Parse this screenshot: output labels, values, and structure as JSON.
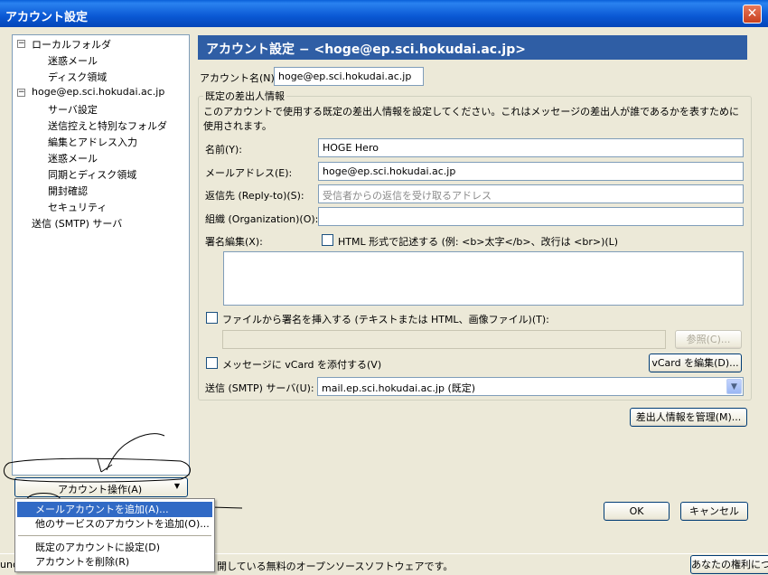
{
  "window": {
    "title": "アカウント設定",
    "close_symbol": "✕"
  },
  "tree": {
    "items": [
      {
        "label": "ローカルフォルダ",
        "expander": "−"
      },
      {
        "label": "迷惑メール"
      },
      {
        "label": "ディスク領域"
      },
      {
        "label": "hoge@ep.sci.hokudai.ac.jp",
        "expander": "−"
      },
      {
        "label": "サーバ設定"
      },
      {
        "label": "送信控えと特別なフォルダ"
      },
      {
        "label": "編集とアドレス入力"
      },
      {
        "label": "迷惑メール"
      },
      {
        "label": "同期とディスク領域"
      },
      {
        "label": "開封確認"
      },
      {
        "label": "セキュリティ"
      },
      {
        "label": "送信 (SMTP) サーバ"
      }
    ]
  },
  "account_ops": {
    "label": "アカウント操作(A)",
    "arrow": "▼"
  },
  "menu": {
    "items": [
      {
        "label": "メールアカウントを追加(A)..."
      },
      {
        "label": "他のサービスのアカウントを追加(O)..."
      },
      {
        "label": "既定のアカウントに設定(D)"
      },
      {
        "label": "アカウントを削除(R)"
      }
    ]
  },
  "banner": {
    "title": "アカウント設定 − <hoge@ep.sci.hokudai.ac.jp>"
  },
  "account_name": {
    "label": "アカウント名(N):",
    "value": "hoge@ep.sci.hokudai.ac.jp"
  },
  "identity": {
    "group_title": "既定の差出人情報",
    "description": "このアカウントで使用する既定の差出人情報を設定してください。これはメッセージの差出人が誰であるかを表すために使用されます。",
    "name_label": "名前(Y):",
    "name_value": "HOGE Hero",
    "email_label": "メールアドレス(E):",
    "email_value": "hoge@ep.sci.hokudai.ac.jp",
    "replyto_label": "返信先 (Reply-to)(S):",
    "replyto_placeholder": "受信者からの返信を受け取るアドレス",
    "org_label": "組織 (Organization)(O):",
    "org_value": "",
    "sig_label": "署名編集(X):",
    "html_checkbox_label": "HTML 形式で記述する (例: <b>太字</b>、改行は <br>)(L)",
    "sig_file_checkbox_label": "ファイルから署名を挿入する (テキストまたは HTML、画像ファイル)(T):",
    "sig_file_value": "",
    "browse_button": "参照(C)...",
    "vcard_checkbox_label": "メッセージに vCard を添付する(V)",
    "vcard_edit_button": "vCard を編集(D)...",
    "smtp_label": "送信 (SMTP) サーバ(U):",
    "smtp_value": "mail.ep.sci.hokudai.ac.jp (既定)",
    "manage_button": "差出人情報を管理(M)..."
  },
  "buttons": {
    "ok": "OK",
    "cancel": "キャンセル"
  },
  "statusbar": {
    "left_fragment": "und",
    "text": "開している無料のオープンソースソフトウェアです。",
    "right_button": "あなたの権利につ"
  }
}
